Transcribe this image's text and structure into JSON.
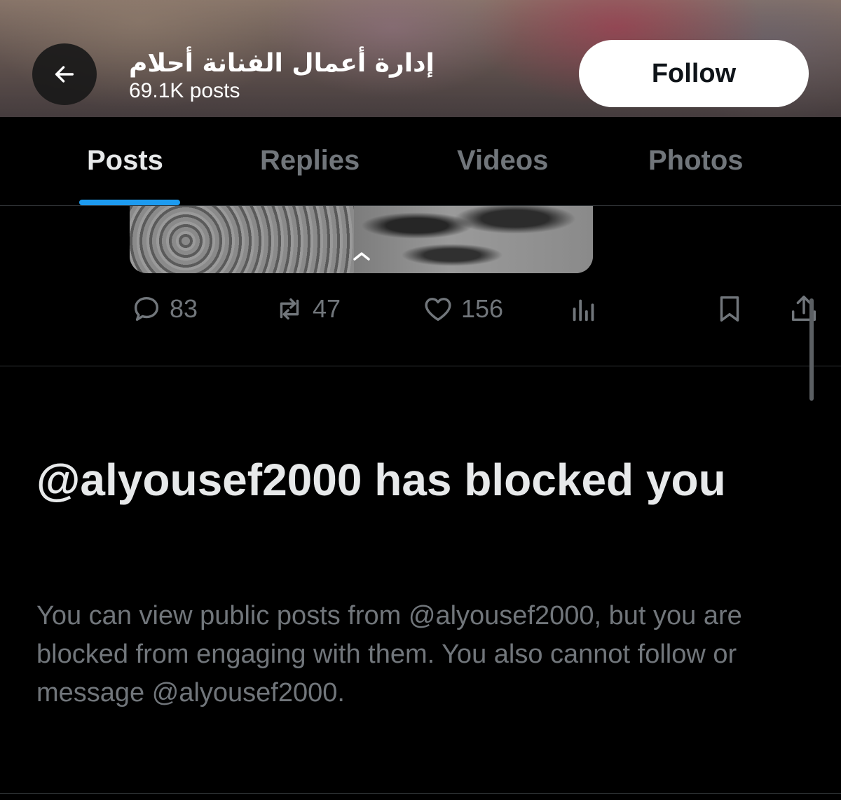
{
  "header": {
    "profile_name": "إدارة أعمال الفنانة أحلام",
    "post_count": "69.1K posts",
    "follow_label": "Follow",
    "back_icon": "arrow-left-icon"
  },
  "tabs": [
    {
      "label": "Posts",
      "active": true
    },
    {
      "label": "Replies",
      "active": false
    },
    {
      "label": "Videos",
      "active": false
    },
    {
      "label": "Photos",
      "active": false
    }
  ],
  "post": {
    "replies": "83",
    "reposts": "47",
    "likes": "156",
    "icons": [
      "reply-icon",
      "repost-icon",
      "heart-icon",
      "analytics-icon",
      "bookmark-icon",
      "share-icon"
    ]
  },
  "blocked": {
    "title": "@alyousef2000 has blocked you",
    "message": "You can view public posts from @alyousef2000, but you are blocked from engaging with them. You also cannot follow or message @alyousef2000."
  },
  "colors": {
    "accent": "#1d9bf0",
    "background": "#000000",
    "muted_text": "#71767b",
    "primary_text": "#e7e9ea"
  }
}
